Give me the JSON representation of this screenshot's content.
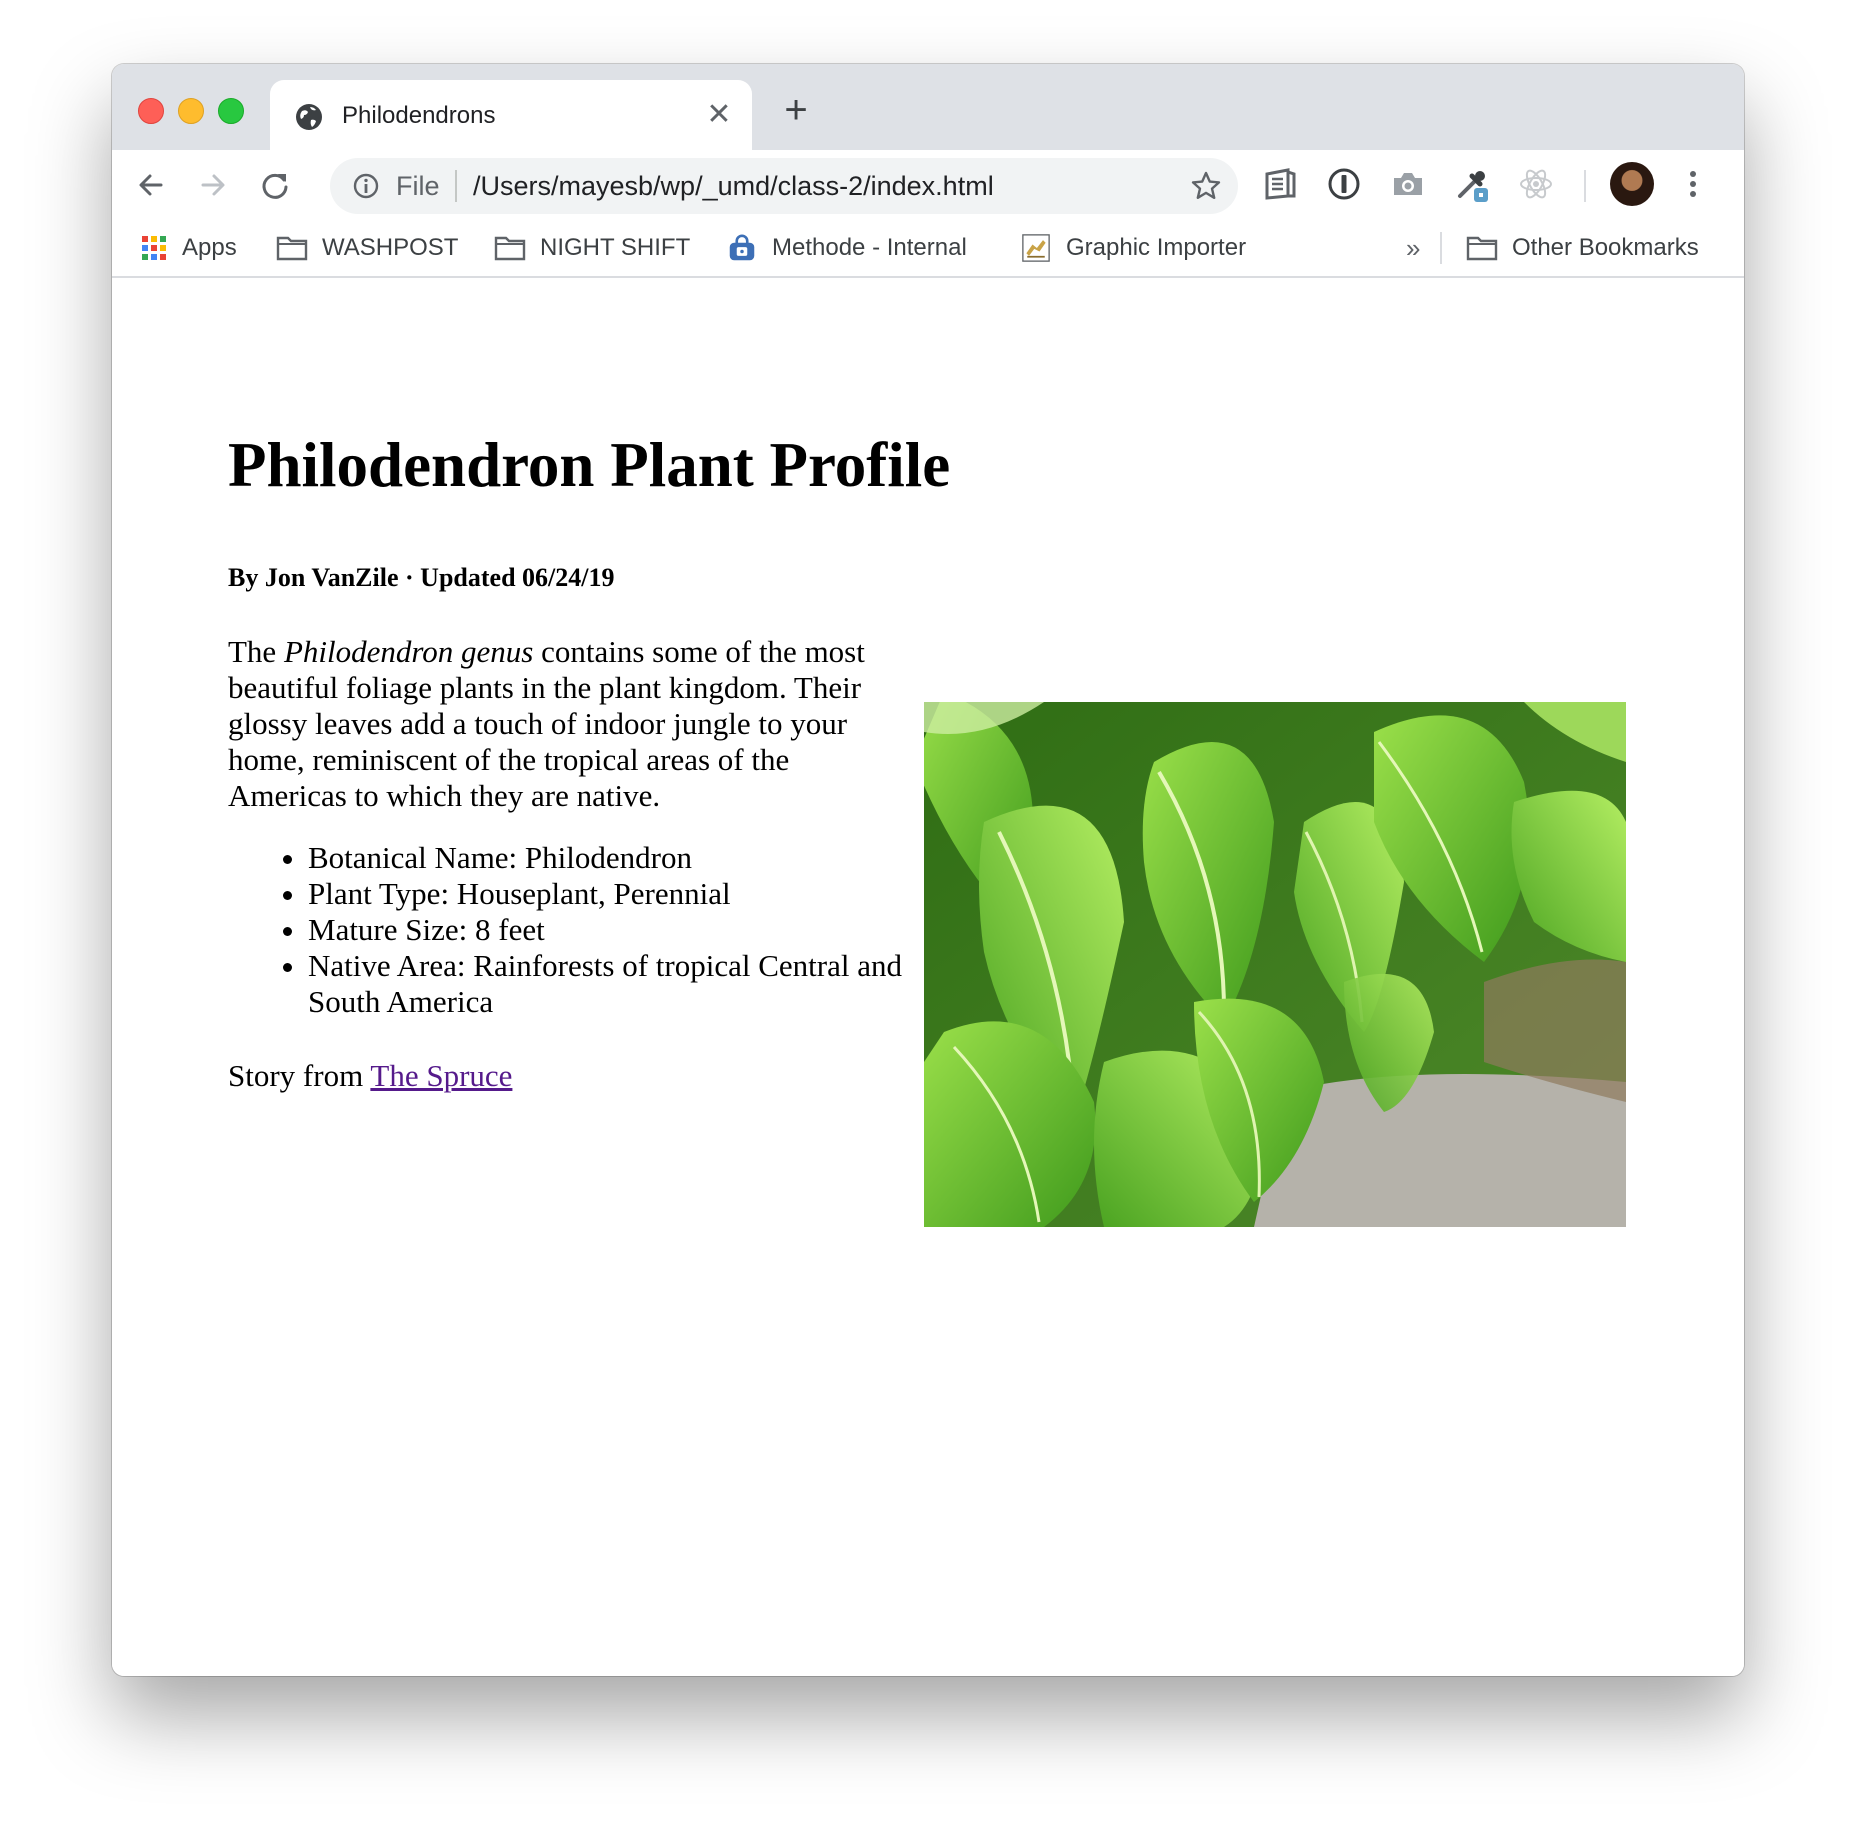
{
  "browser": {
    "tab_title": "Philodendrons",
    "tab_close": "✕",
    "new_tab": "+",
    "omnibox": {
      "scheme_label": "File",
      "url": "/Users/mayesb/wp/_umd/class-2/index.html"
    },
    "bookmarks": [
      {
        "label": "Apps",
        "icon": "apps-grid-icon"
      },
      {
        "label": "WASHPOST",
        "icon": "folder-icon"
      },
      {
        "label": "NIGHT SHIFT",
        "icon": "folder-icon"
      },
      {
        "label": "Methode - Internal",
        "icon": "lock-badge-icon"
      },
      {
        "label": "Graphic Importer",
        "icon": "importer-favicon"
      }
    ],
    "bookmarks_overflow": "»",
    "other_bookmarks": "Other Bookmarks"
  },
  "page": {
    "title": "Philodendron Plant Profile",
    "byline": "By Jon VanZile · Updated 06/24/19",
    "intro": {
      "before": "The ",
      "emphasis": "Philodendron genus",
      "after": " contains some of the most beautiful foliage plants in the plant kingdom. Their glossy leaves add a touch of indoor jungle to your home, reminiscent of the tropical areas of the Americas to which they are native."
    },
    "facts": [
      "Botanical Name: Philodendron",
      "Plant Type: Houseplant, Perennial",
      "Mature Size: 8 feet",
      "Native Area: Rainforests of tropical Central and South America"
    ],
    "source": {
      "prefix": "Story from ",
      "link_text": "The Spruce"
    }
  }
}
